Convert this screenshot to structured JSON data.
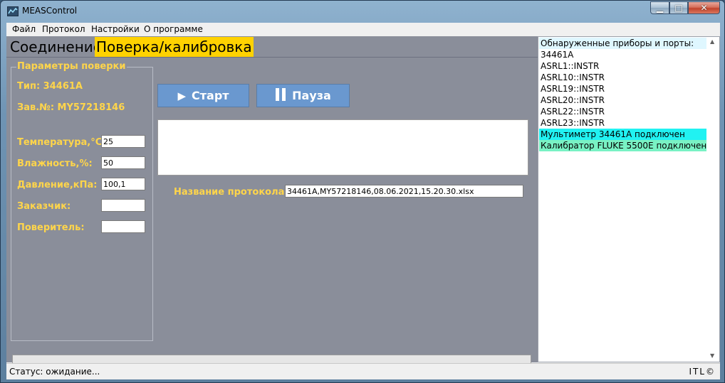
{
  "window": {
    "title": "MEASControl"
  },
  "menu": [
    "Файл",
    "Протокол",
    "Настройки",
    "О программе"
  ],
  "tabs": {
    "connection": "Соединение",
    "calibration": "Поверка/калибровка"
  },
  "params": {
    "group_title": "Параметры поверки",
    "type": "Тип: 34461A",
    "serial": "Зав.№: MY57218146",
    "temperature_label": "Температура,°С:",
    "temperature_value": "25",
    "humidity_label": "Влажность,%:",
    "humidity_value": "50",
    "pressure_label": "Давление,кПа:",
    "pressure_value": "100,1",
    "customer_label": "Заказчик:",
    "customer_value": "",
    "verifier_label": "Поверитель:",
    "verifier_value": ""
  },
  "controls": {
    "start_label": "Старт",
    "pause_label": "Пауза"
  },
  "protocol": {
    "label": "Название протокола:",
    "value": "34461A,MY57218146,08.06.2021,15.20.30.xlsx"
  },
  "devices": {
    "items": [
      {
        "text": "Обнаруженные приборы и порты:",
        "bg": "#dff7ff"
      },
      {
        "text": "34461A",
        "bg": "#ffffff"
      },
      {
        "text": "ASRL1::INSTR",
        "bg": "#ffffff"
      },
      {
        "text": "ASRL10::INSTR",
        "bg": "#ffffff"
      },
      {
        "text": "ASRL19::INSTR",
        "bg": "#ffffff"
      },
      {
        "text": "ASRL20::INSTR",
        "bg": "#ffffff"
      },
      {
        "text": "ASRL22::INSTR",
        "bg": "#ffffff"
      },
      {
        "text": "ASRL23::INSTR",
        "bg": "#ffffff"
      },
      {
        "text": "Мультиметр 34461A подключен",
        "bg": "#21f2f2"
      },
      {
        "text": "Калибратор FLUKE 5500E подключен",
        "bg": "#79f2c4"
      }
    ]
  },
  "status": {
    "text": "Статус: ожидание...",
    "right": "ITL©"
  },
  "colors": {
    "accent_tab": "#ffd200",
    "label_text": "#ffd54a",
    "button": "#6a98cf",
    "panel": "#8a8e9a"
  }
}
